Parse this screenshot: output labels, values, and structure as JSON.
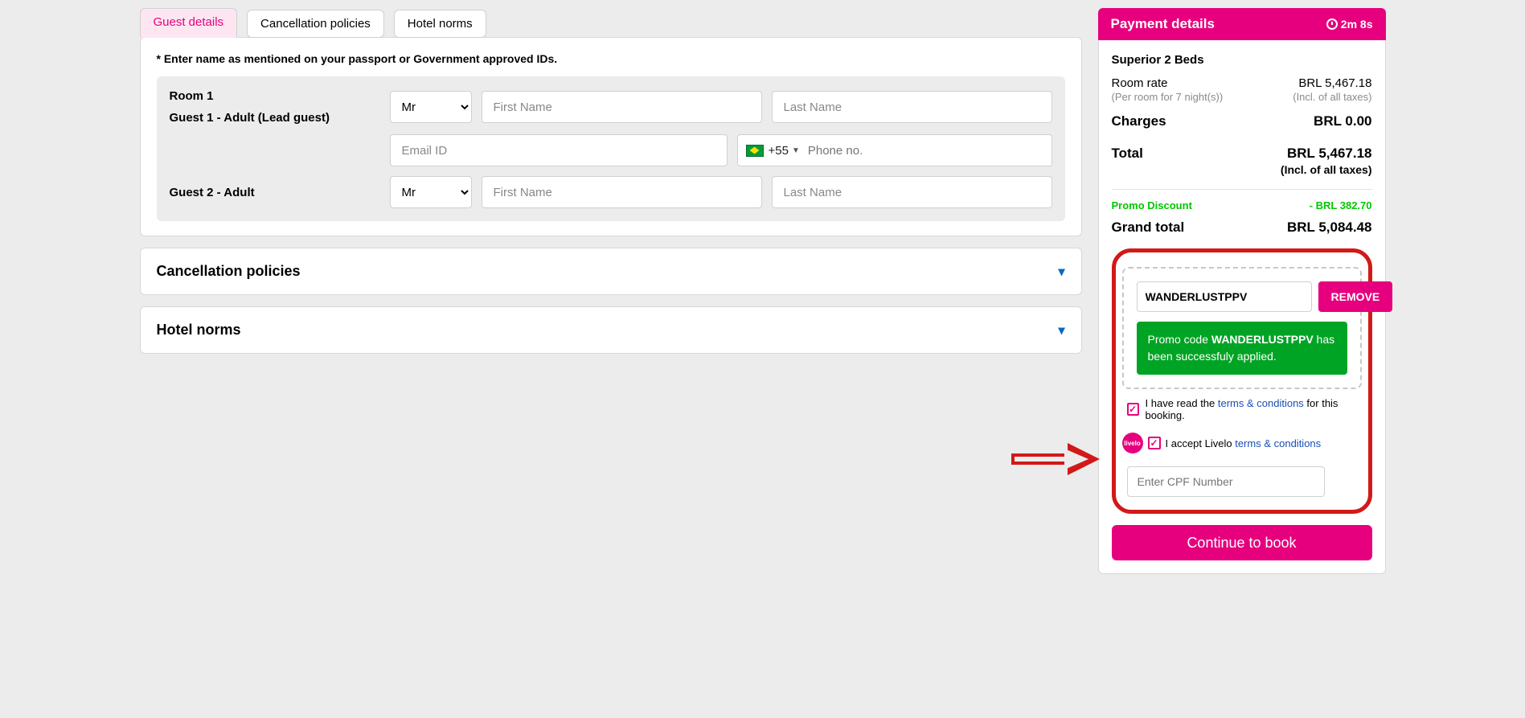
{
  "tabs": {
    "guest_details": "Guest details",
    "cancellation": "Cancellation policies",
    "hotel_norms": "Hotel norms"
  },
  "passport_note": "* Enter name as mentioned on your passport or Government approved IDs.",
  "room1_label": "Room 1",
  "guest1_label": "Guest 1 - Adult (Lead guest)",
  "guest2_label": "Guest 2 - Adult",
  "title_options": {
    "selected": "Mr"
  },
  "placeholders": {
    "first_name": "First Name",
    "last_name": "Last Name",
    "email": "Email ID",
    "phone": "Phone no.",
    "cpf": "Enter CPF Number"
  },
  "phone_cc": "+55",
  "accordion": {
    "cancel": "Cancellation policies",
    "norms": "Hotel norms"
  },
  "payment": {
    "header": "Payment details",
    "timer": "2m 8s",
    "room_type": "Superior 2 Beds",
    "room_rate_label": "Room rate",
    "room_rate_sub": "(Per room for 7 night(s))",
    "room_rate_value": "BRL 5,467.18",
    "incl_taxes": "(Incl. of all taxes)",
    "charges_label": "Charges",
    "charges_value": "BRL 0.00",
    "total_label": "Total",
    "total_value": "BRL 5,467.18",
    "promo_discount_label": "Promo Discount",
    "promo_discount_value": "- BRL 382.70",
    "grand_total_label": "Grand total",
    "grand_total_value": "BRL 5,084.48",
    "promo_code": "WANDERLUSTPPV",
    "remove_btn": "REMOVE",
    "success_prefix": "Promo code ",
    "success_code": "WANDERLUSTPPV",
    "success_suffix": " has been successfuly applied.",
    "terms_prefix": "I have read the ",
    "terms_link": "terms & conditions",
    "terms_suffix": " for this booking.",
    "livelo_prefix": "I accept Livelo ",
    "livelo_link": "terms & conditions",
    "livelo_badge": "livelo",
    "continue_btn": "Continue to book"
  }
}
